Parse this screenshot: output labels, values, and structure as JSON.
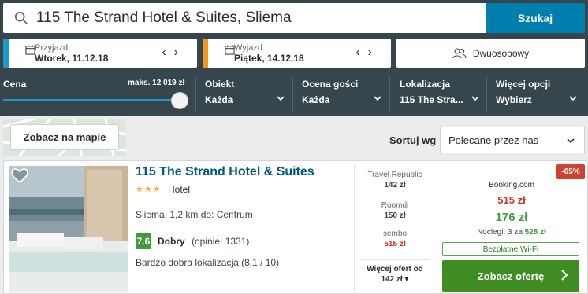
{
  "search": {
    "query": "115 The Strand Hotel & Suites, Sliema",
    "button_label": "Szukaj"
  },
  "dates": {
    "checkin": {
      "label": "Przyjazd",
      "value": "Wtorek, 11.12.18"
    },
    "checkout": {
      "label": "Wyjazd",
      "value": "Piątek, 14.12.18"
    },
    "checkin_accent": "#1a9ac9",
    "checkout_accent": "#f3971c"
  },
  "rooms": {
    "label": "Dwuosobowy"
  },
  "filters": {
    "price": {
      "label": "Cena",
      "max_label": "maks. 12 019 zł",
      "slider_fraction": 1.0
    },
    "property": {
      "label": "Obiekt",
      "value": "Każda"
    },
    "rating": {
      "label": "Ocena gości",
      "value": "Każda"
    },
    "location": {
      "label": "Lokalizacja",
      "value": "115 The Stra..."
    },
    "more": {
      "label": "Więcej opcji",
      "value": "Wybierz"
    }
  },
  "map": {
    "button_label": "Zobacz na mapie"
  },
  "sort": {
    "label": "Sortuj wg",
    "value": "Polecane przez nas"
  },
  "hotel": {
    "name": "115 The Strand Hotel & Suites",
    "stars": "★★★",
    "type": "Hotel",
    "location": "Sliema, 1,2 km do: Centrum",
    "rating_score": "7.6",
    "rating_word": "Dobry",
    "rating_count": "(opinie: 1331)",
    "rating_note": "Bardzo dobra lokalizacja (8.1 / 10)"
  },
  "offers": [
    {
      "site": "Travel Republic",
      "price": "142 zł",
      "price_color": "#37454d"
    },
    {
      "site": "Roomdi",
      "price": "150 zł",
      "price_color": "#37454d"
    },
    {
      "site": "sembo",
      "price": "515 zł",
      "price_color": "#c9302c"
    }
  ],
  "more_offers": {
    "label": "Więcej ofert od",
    "value": "142 zł ▾"
  },
  "best_deal": {
    "discount": "-65%",
    "site": "Booking.com",
    "old_price": "515 zł",
    "new_price": "176 zł",
    "nights_text": "Noclegi: 3 za",
    "nights_total": "528 zł",
    "amenity": "Bezpłatne Wi-Fi",
    "cta_label": "Zobacz ofertę"
  }
}
